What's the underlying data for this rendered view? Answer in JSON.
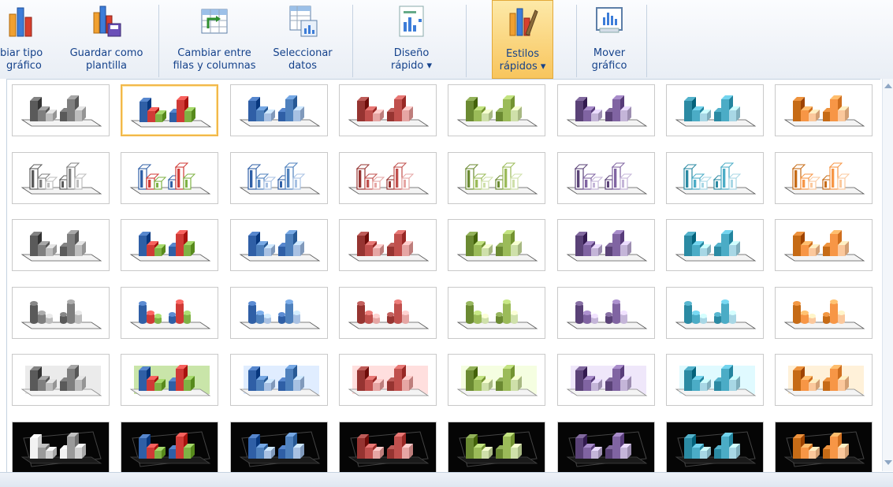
{
  "ribbon": {
    "buttons": [
      {
        "id": "change-type",
        "label1": "biar tipo",
        "label2": "gráfico",
        "icon": "column-chart-icon"
      },
      {
        "id": "save-template",
        "label1": "Guardar como",
        "label2": "plantilla",
        "icon": "save-template-icon"
      },
      {
        "id": "switch-row-col",
        "label1": "Cambiar entre",
        "label2": "filas y columnas",
        "icon": "switch-rows-columns-icon"
      },
      {
        "id": "select-data",
        "label1": "Seleccionar",
        "label2": "datos",
        "icon": "select-data-icon"
      },
      {
        "id": "quick-layout",
        "label1": "Diseño",
        "label2": "rápido ▾",
        "icon": "quick-layout-icon"
      },
      {
        "id": "quick-styles",
        "label1": "Estilos",
        "label2": "rápidos ▾",
        "icon": "quick-styles-icon"
      },
      {
        "id": "move-chart",
        "label1": "Mover",
        "label2": "gráfico",
        "icon": "move-chart-icon"
      }
    ]
  },
  "gallery": {
    "selected": {
      "row": 0,
      "col": 1
    },
    "colors": [
      {
        "name": "gray",
        "dark": "#5a5a5a",
        "mid": "#7f7f7f",
        "light": "#bdbdbd"
      },
      {
        "name": "multi",
        "dark": "#2f5fa6",
        "mid": "#d03a36",
        "light": "#7fb244"
      },
      {
        "name": "blue",
        "dark": "#2f5fa6",
        "mid": "#4f81bd",
        "light": "#a8c1e3"
      },
      {
        "name": "red",
        "dark": "#963431",
        "mid": "#c0504d",
        "light": "#e6a6a4"
      },
      {
        "name": "green",
        "dark": "#6b8a32",
        "mid": "#9bbb59",
        "light": "#cfe0aa"
      },
      {
        "name": "purple",
        "dark": "#5a4277",
        "mid": "#8064a2",
        "light": "#c4b5d8"
      },
      {
        "name": "aqua",
        "dark": "#2b8aa3",
        "mid": "#4bacc6",
        "light": "#a8d7e5"
      },
      {
        "name": "orange",
        "dark": "#c66b16",
        "mid": "#f79646",
        "light": "#fbc89c"
      }
    ],
    "rows": [
      {
        "style": "solid",
        "bg": "#ffffff",
        "floor": "#555555"
      },
      {
        "style": "outline",
        "bg": "#ffffff",
        "floor": "#555555"
      },
      {
        "style": "solid",
        "bg": "#ffffff",
        "floor": "#555555"
      },
      {
        "style": "rounded",
        "bg": "#ffffff",
        "floor": "#555555"
      },
      {
        "style": "shaded",
        "bg": "#ffffff",
        "floor": "#888888"
      },
      {
        "style": "dark",
        "bg": "#050505",
        "floor": "#444444"
      }
    ]
  }
}
